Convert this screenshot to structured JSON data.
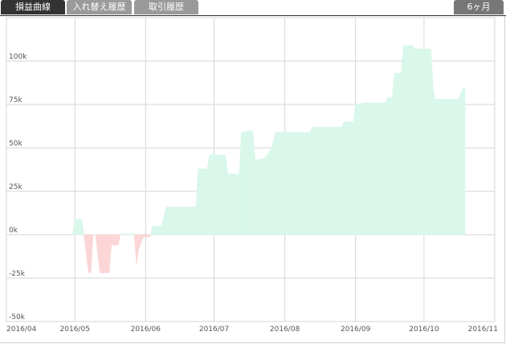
{
  "tabs": [
    {
      "label": "損益曲線",
      "active": true
    },
    {
      "label": "入れ替え履歴",
      "active": false
    },
    {
      "label": "取引履歴",
      "active": false
    }
  ],
  "period_selector": {
    "label": "6ヶ月"
  },
  "colors": {
    "tab_active": "#333333",
    "tab_inactive": "#9a9a9a",
    "gain_fill": "#d9f7ea",
    "loss_fill": "#fcd6d6",
    "grid": "#d6d6d6"
  },
  "chart_data": {
    "type": "area",
    "title": "",
    "xlabel": "",
    "ylabel": "",
    "x_tick_labels": [
      "2016/04",
      "2016/05",
      "2016/06",
      "2016/07",
      "2016/08",
      "2016/09",
      "2016/10",
      "2016/11"
    ],
    "y_tick_labels": [
      "100k",
      "75k",
      "50k",
      "25k",
      "0k",
      "-25k",
      "-50k"
    ],
    "y_ticks": [
      100000,
      75000,
      50000,
      25000,
      0,
      -25000,
      -50000
    ],
    "ylim": [
      -50000,
      125000
    ],
    "xlim": [
      "2016-04-01",
      "2016-11-01"
    ],
    "grid": true,
    "legend": "none",
    "series": [
      {
        "points": [
          [
            "2016-04-30",
            0
          ],
          [
            "2016-05-01",
            9000
          ],
          [
            "2016-05-04",
            9000
          ],
          [
            "2016-05-05",
            0
          ],
          [
            "2016-05-06",
            -12000
          ],
          [
            "2016-05-07",
            -22000
          ],
          [
            "2016-05-08",
            -22000
          ],
          [
            "2016-05-09",
            0
          ],
          [
            "2016-05-10",
            0
          ],
          [
            "2016-05-12",
            -22000
          ],
          [
            "2016-05-16",
            -22000
          ],
          [
            "2016-05-17",
            -6000
          ],
          [
            "2016-05-20",
            -6000
          ],
          [
            "2016-05-21",
            500
          ],
          [
            "2016-05-27",
            500
          ],
          [
            "2016-05-28",
            -17000
          ],
          [
            "2016-05-29",
            -8000
          ],
          [
            "2016-05-31",
            -1500
          ],
          [
            "2016-06-03",
            -1000
          ],
          [
            "2016-06-04",
            5000
          ],
          [
            "2016-06-08",
            5000
          ],
          [
            "2016-06-10",
            16000
          ],
          [
            "2016-06-23",
            16000
          ],
          [
            "2016-06-24",
            38000
          ],
          [
            "2016-06-28",
            38000
          ],
          [
            "2016-06-29",
            46000
          ],
          [
            "2016-07-06",
            46000
          ],
          [
            "2016-07-07",
            35000
          ],
          [
            "2016-07-12",
            35000
          ],
          [
            "2016-07-13",
            59000
          ],
          [
            "2016-07-18",
            60000
          ],
          [
            "2016-07-19",
            43000
          ],
          [
            "2016-07-23",
            44000
          ],
          [
            "2016-07-26",
            49000
          ],
          [
            "2016-07-28",
            59000
          ],
          [
            "2016-08-12",
            59000
          ],
          [
            "2016-08-13",
            62000
          ],
          [
            "2016-08-26",
            62000
          ],
          [
            "2016-08-27",
            65000
          ],
          [
            "2016-08-31",
            65000
          ],
          [
            "2016-09-01",
            75000
          ],
          [
            "2016-09-05",
            76000
          ],
          [
            "2016-09-14",
            76000
          ],
          [
            "2016-09-15",
            79000
          ],
          [
            "2016-09-17",
            79000
          ],
          [
            "2016-09-18",
            93000
          ],
          [
            "2016-09-21",
            93000
          ],
          [
            "2016-09-22",
            109000
          ],
          [
            "2016-09-26",
            109000
          ],
          [
            "2016-09-27",
            107000
          ],
          [
            "2016-10-04",
            107000
          ],
          [
            "2016-10-05",
            85000
          ],
          [
            "2016-10-06",
            78000
          ],
          [
            "2016-10-16",
            78000
          ],
          [
            "2016-10-18",
            84000
          ],
          [
            "2016-10-19",
            85000
          ],
          [
            "2016-10-19",
            0
          ]
        ]
      }
    ]
  }
}
